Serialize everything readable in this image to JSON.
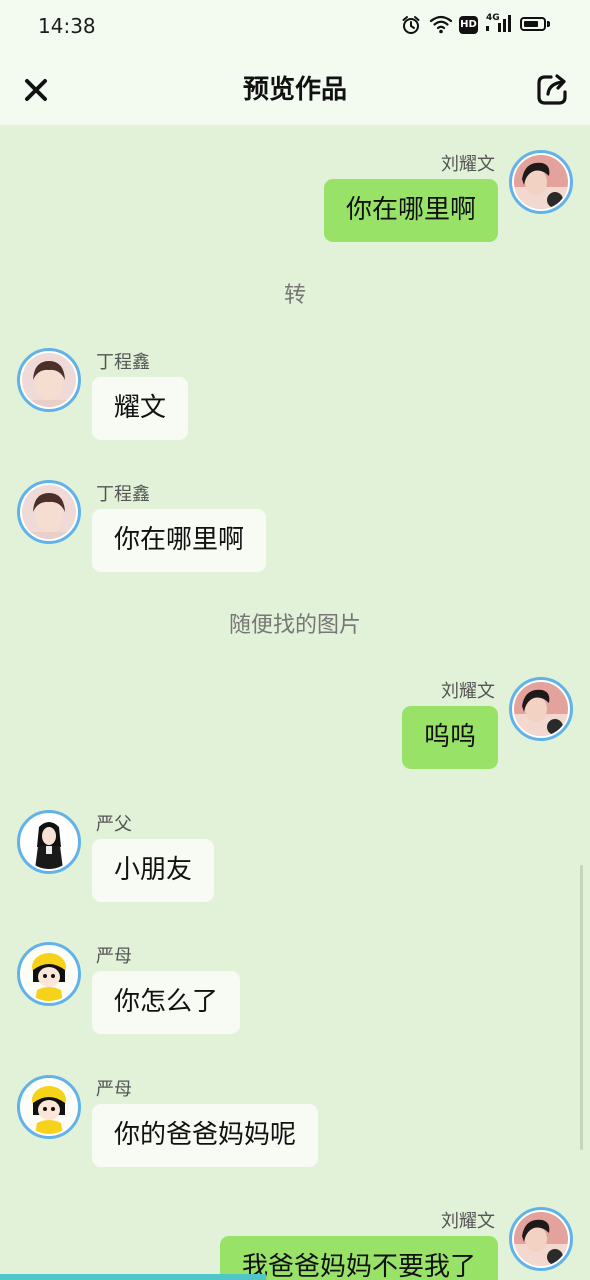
{
  "status_bar": {
    "time": "14:38",
    "hd_label": "HD",
    "network_label": "4G",
    "battery_level": 0.8,
    "icons": [
      "alarm-icon",
      "wifi-icon",
      "hd-icon",
      "signal-icon",
      "battery-icon"
    ]
  },
  "header": {
    "title": "预览作品",
    "left_icon": "close-icon",
    "right_icon": "share-icon"
  },
  "chat": {
    "items": [
      {
        "sender": "刘耀文",
        "text": "你在哪里啊"
      },
      {
        "text": "转"
      },
      {
        "sender": "丁程鑫",
        "text": "耀文"
      },
      {
        "sender": "丁程鑫",
        "text": "你在哪里啊"
      },
      {
        "text": "随便找的图片"
      },
      {
        "sender": "刘耀文",
        "text": "呜呜"
      },
      {
        "sender": "严父",
        "text": "小朋友"
      },
      {
        "sender": "严母",
        "text": "你怎么了"
      },
      {
        "sender": "严母",
        "text": "你的爸爸妈妈呢"
      },
      {
        "sender": "刘耀文",
        "text": "我爸爸妈妈不要我了"
      }
    ]
  },
  "bottom_indicator": {
    "progress": 0.45
  },
  "colors": {
    "chat_background": "#e2f2d9",
    "header_background": "#f3fbf0",
    "outgoing_bubble": "#98e267",
    "incoming_bubble": "#f7fbf4",
    "avatar_ring": "#62b2ea",
    "indicator": "#4fc6c8"
  }
}
